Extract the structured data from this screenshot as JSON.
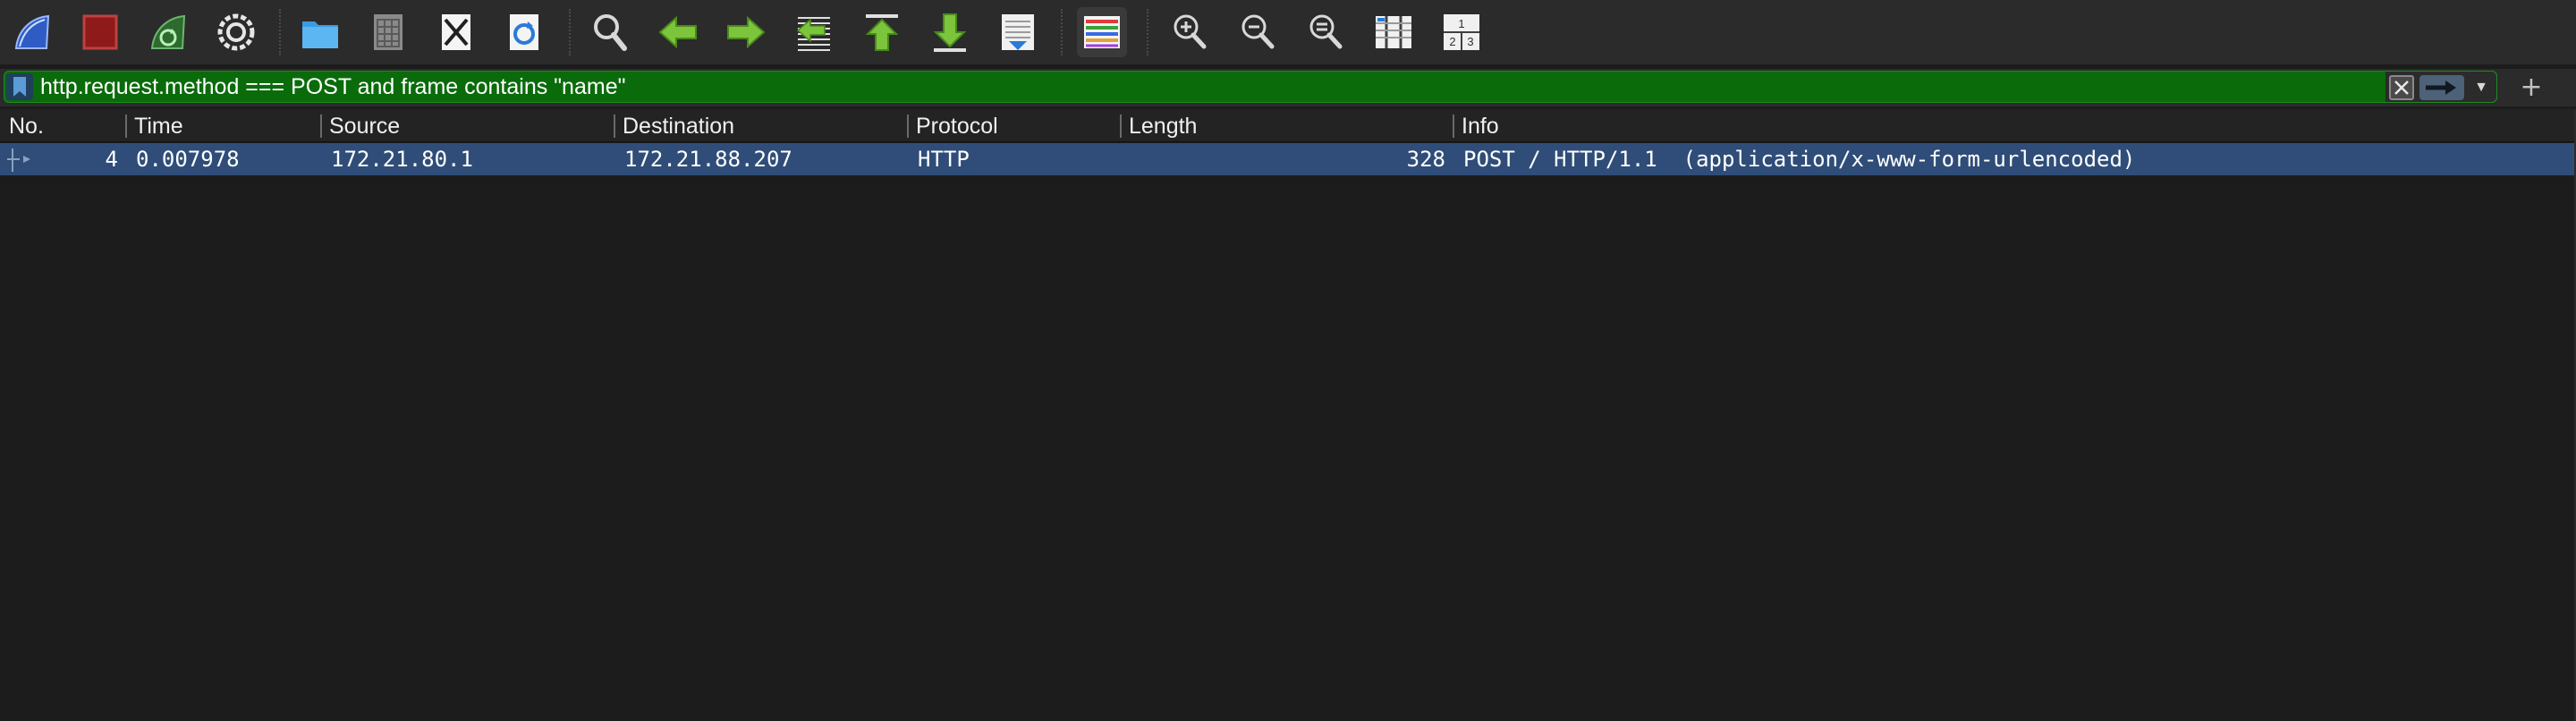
{
  "toolbar": {
    "items": [
      {
        "name": "start-capture-icon",
        "label": "Start capture"
      },
      {
        "name": "stop-capture-icon",
        "label": "Stop capture"
      },
      {
        "name": "restart-capture-icon",
        "label": "Restart capture"
      },
      {
        "name": "capture-options-icon",
        "label": "Capture options"
      },
      {
        "name": "open-file-icon",
        "label": "Open"
      },
      {
        "name": "save-file-icon",
        "label": "Save"
      },
      {
        "name": "close-file-icon",
        "label": "Close"
      },
      {
        "name": "reload-file-icon",
        "label": "Reload"
      },
      {
        "name": "find-packet-icon",
        "label": "Find packet"
      },
      {
        "name": "go-back-icon",
        "label": "Back"
      },
      {
        "name": "go-forward-icon",
        "label": "Forward"
      },
      {
        "name": "go-to-packet-icon",
        "label": "Go to packet"
      },
      {
        "name": "go-first-packet-icon",
        "label": "First packet"
      },
      {
        "name": "go-last-packet-icon",
        "label": "Last packet"
      },
      {
        "name": "auto-scroll-icon",
        "label": "Auto scroll"
      },
      {
        "name": "colorize-icon",
        "label": "Colorize"
      },
      {
        "name": "zoom-in-icon",
        "label": "Zoom in"
      },
      {
        "name": "zoom-out-icon",
        "label": "Zoom out"
      },
      {
        "name": "normal-size-icon",
        "label": "Normal size"
      },
      {
        "name": "resize-columns-icon",
        "label": "Resize columns"
      },
      {
        "name": "layout-icon",
        "label": "Layout"
      }
    ]
  },
  "filter": {
    "value": "http.request.method === POST and frame contains \"name\"",
    "color": "#0a6b0a"
  },
  "packet_list": {
    "columns": [
      "No.",
      "Time",
      "Source",
      "Destination",
      "Protocol",
      "Length",
      "Info"
    ],
    "rows": [
      {
        "no": "4",
        "time": "0.007978",
        "source": "172.21.80.1",
        "destination": "172.21.88.207",
        "protocol": "HTTP",
        "length": "328",
        "info": "POST / HTTP/1.1  (application/x-www-form-urlencoded)"
      }
    ],
    "selected_row_color": "#2f4d78"
  }
}
